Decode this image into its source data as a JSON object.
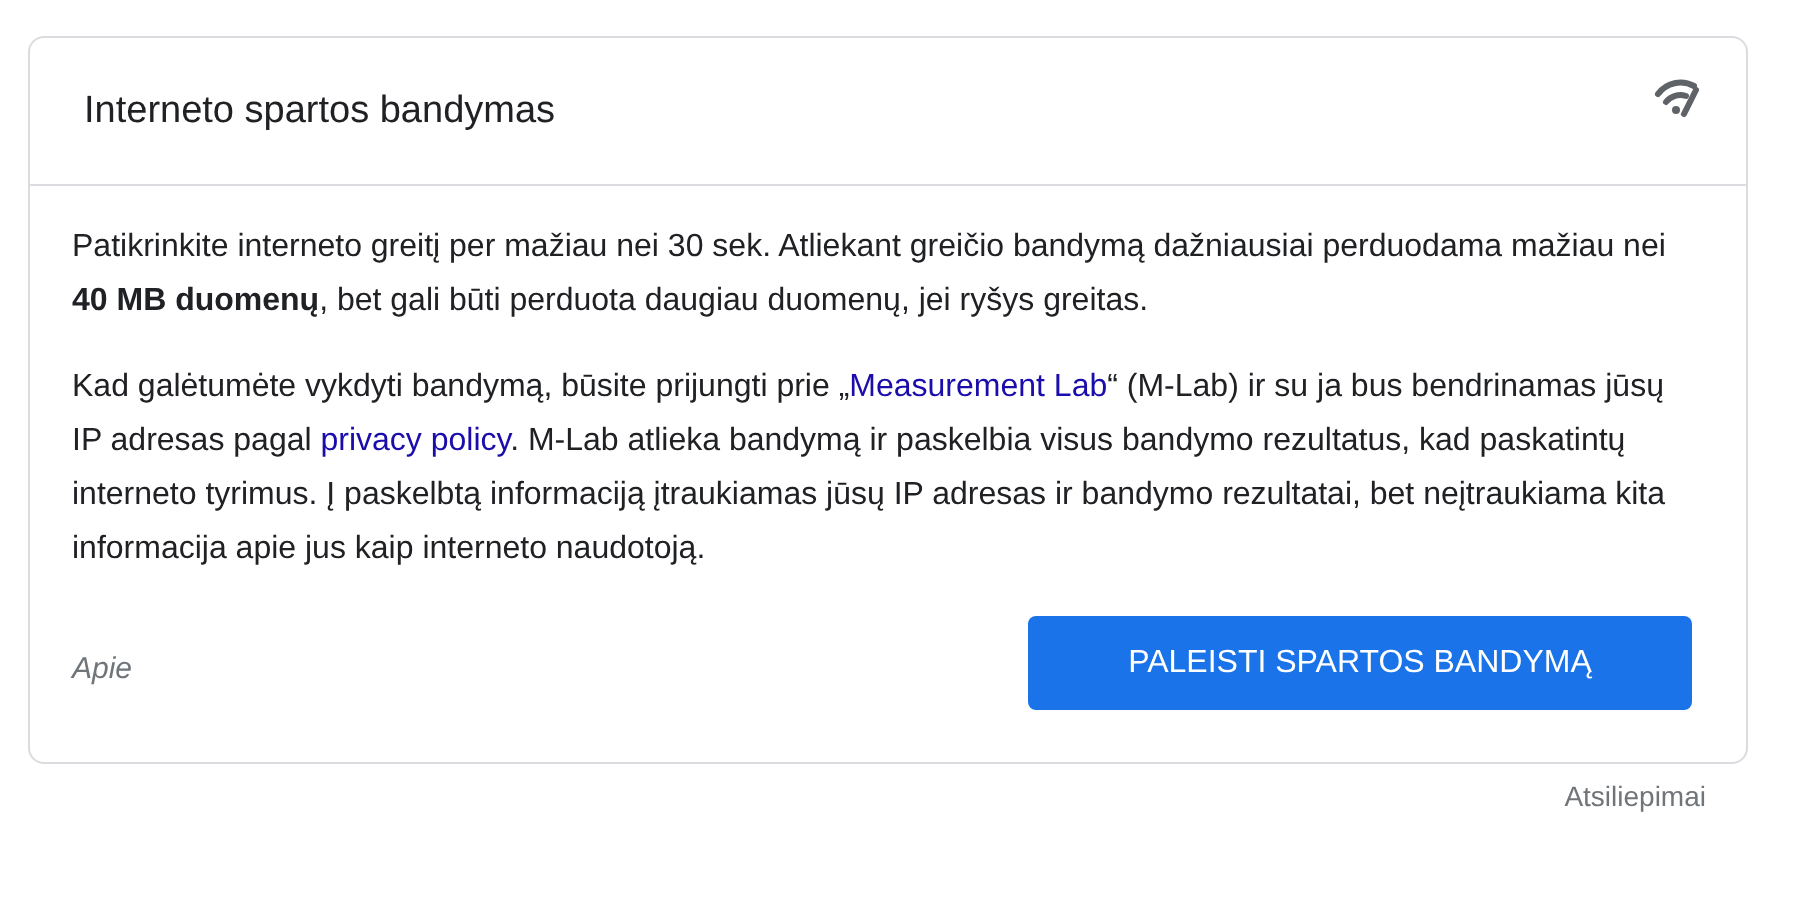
{
  "card": {
    "title": "Interneto spartos bandymas",
    "paragraphs": [
      {
        "parts": [
          {
            "kind": "text",
            "text": "Patikrinkite interneto greitį per mažiau nei 30 sek. Atliekant greičio bandymą dažniausiai perduodama mažiau nei **40 MB duomenų**, bet gali būti perduota daugiau duomenų, jei ryšys greitas."
          }
        ]
      },
      {
        "parts": [
          {
            "kind": "text",
            "text": "Kad galėtumėte vykdyti bandymą, būsite prijungti prie „"
          },
          {
            "kind": "link",
            "text": "Measurement Lab"
          },
          {
            "kind": "text",
            "text": "“ (M-Lab) ir su ja bus bendrinamas jūsų IP adresas pagal "
          },
          {
            "kind": "link",
            "text": "privacy policy"
          },
          {
            "kind": "text",
            "text": ". M-Lab atlieka bandymą ir paskelbia visus bandymo rezultatus, kad paskatintų interneto tyrimus. Į paskelbtą informaciją įtraukiamas jūsų IP adresas ir bandymo rezultatai, bet neįtraukiama kita informacija apie jus kaip interneto naudotoją."
          }
        ]
      }
    ],
    "about_link": "Apie",
    "button": "PALEISTI SPARTOS BANDYMĄ"
  },
  "feedback_link": "Atsiliepimai"
}
